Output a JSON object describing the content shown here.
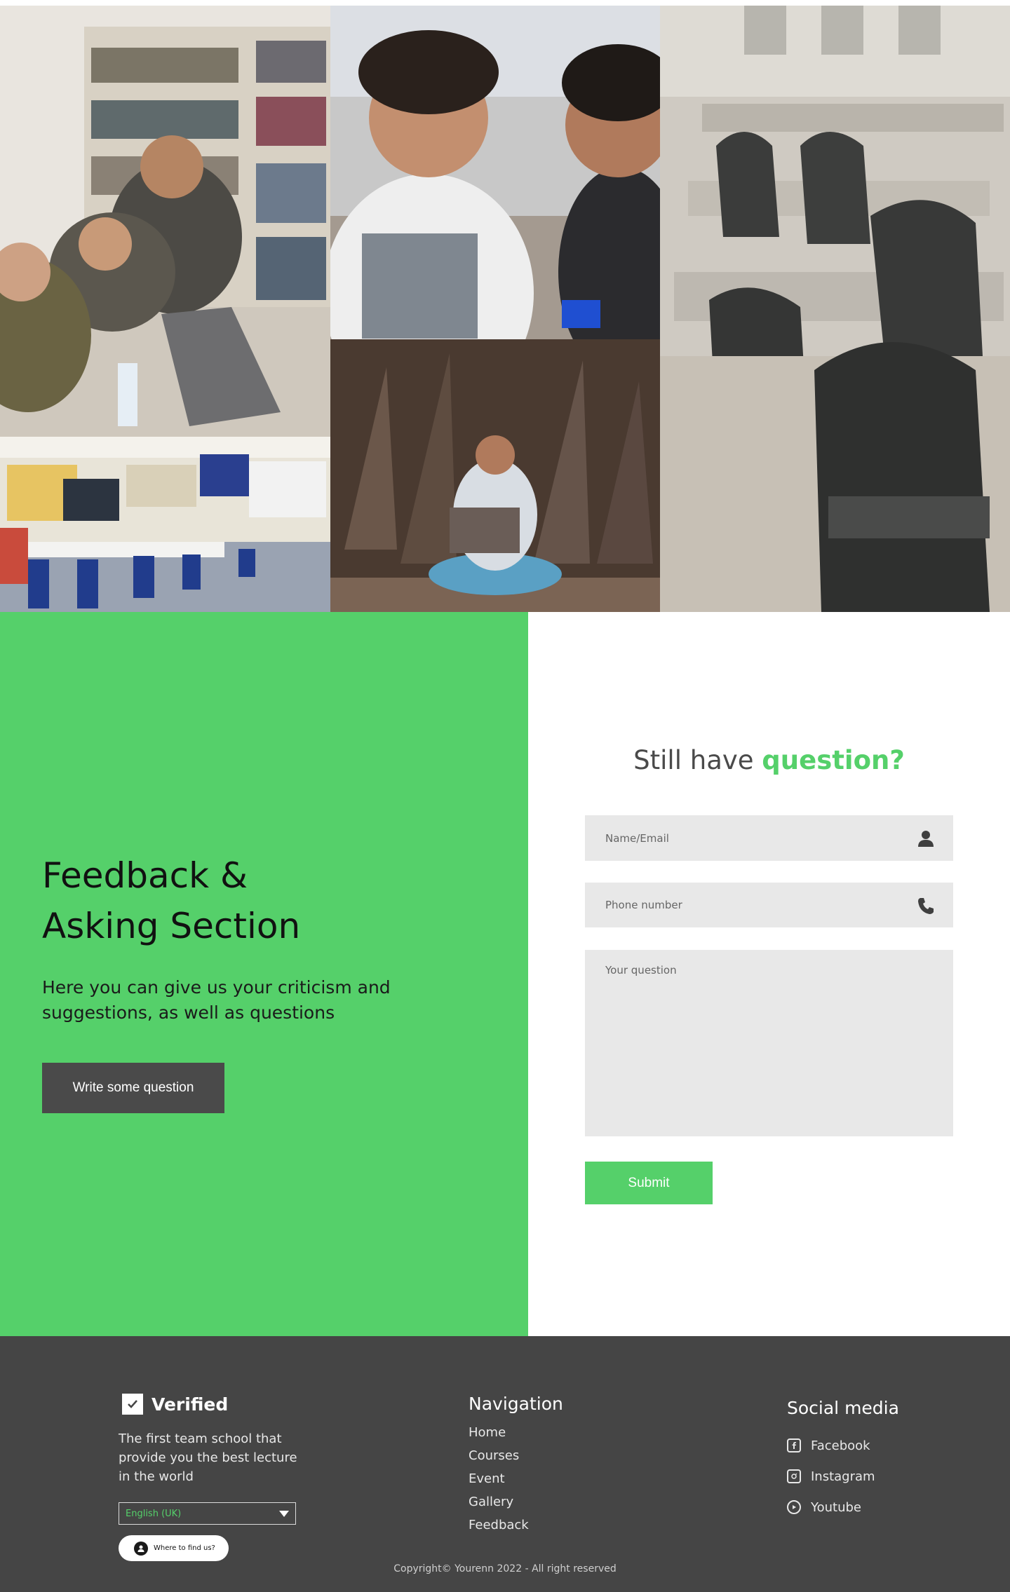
{
  "gallery": {
    "photos": [
      {
        "name": "library-study-photo"
      },
      {
        "name": "students-smiling-photo"
      },
      {
        "name": "empty-classroom-chairs-photo"
      },
      {
        "name": "classroom-photo"
      },
      {
        "name": "girl-with-laptop-photo"
      }
    ]
  },
  "feedback": {
    "title_line1": "Feedback &",
    "title_line2": "Asking Section",
    "description": "Here you can give us your criticism and suggestions, as well as questions",
    "cta_label": "Write some question"
  },
  "form": {
    "title_prefix": "Still have ",
    "title_accent": "question?",
    "name_placeholder": "Name/Email",
    "phone_placeholder": "Phone number",
    "question_placeholder": "Your question",
    "submit_label": "Submit",
    "accent_color": "#55d06a"
  },
  "footer": {
    "brand": "Verified",
    "tagline": "The first team school that provide you the best lecture in the world",
    "language": "English (UK)",
    "find_us_label": "Where to find us?",
    "navigation_title": "Navigation",
    "navigation": [
      "Home",
      "Courses",
      "Event",
      "Gallery",
      "Feedback"
    ],
    "social_title": "Social media",
    "social": [
      {
        "label": "Facebook",
        "icon": "facebook-icon"
      },
      {
        "label": "Instagram",
        "icon": "instagram-icon"
      },
      {
        "label": "Youtube",
        "icon": "youtube-icon"
      }
    ],
    "copyright": "Copyright© Yourenn 2022 - All right reserved"
  }
}
